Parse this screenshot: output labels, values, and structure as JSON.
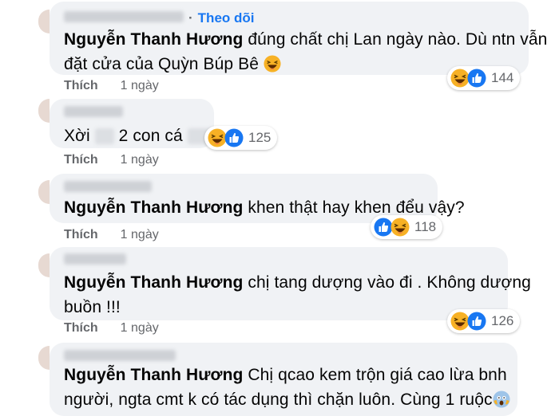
{
  "follow_label": "Theo dõi",
  "comments": [
    {
      "author": "Nguyễn Thanh Hương",
      "text_main": " đúng chất chị Lan ngày nào. Dù ntn vẫn",
      "text_line2": "đặt cửa của Quỳn Búp Bê ",
      "like_label": "Thích",
      "time": "1 ngày",
      "reaction_count": "144"
    },
    {
      "text_start": "Xời",
      "text_mid": " 2 con cá",
      "like_label": "Thích",
      "time": "1 ngày",
      "reaction_count": "125"
    },
    {
      "author": "Nguyễn Thanh Hương",
      "text_main": " khen thật hay khen đểu vậy?",
      "like_label": "Thích",
      "time": "1 ngày",
      "reaction_count": "118"
    },
    {
      "author": "Nguyễn Thanh Hương",
      "text_main": " chị tang dượng vào đi . Không dượng",
      "text_line2": "buồn !!!",
      "like_label": "Thích",
      "time": "1 ngày",
      "reaction_count": "126"
    },
    {
      "author": "Nguyễn Thanh Hương",
      "text_main": " Chị qcao kem trộn giá cao lừa bnh",
      "text_line2": "người, ngta cmt k có tác dụng thì chặn luôn. Cùng 1 ruộc",
      "like_label": "",
      "time": ""
    }
  ],
  "colors": {
    "bubble": "#f0f2f5",
    "link_blue": "#1877f2",
    "meta_gray": "#65676b",
    "like_blue": "#1877f2",
    "haha_yellow": "#f7b125"
  },
  "icons": [
    "haha-icon",
    "like-icon",
    "scream-icon"
  ]
}
